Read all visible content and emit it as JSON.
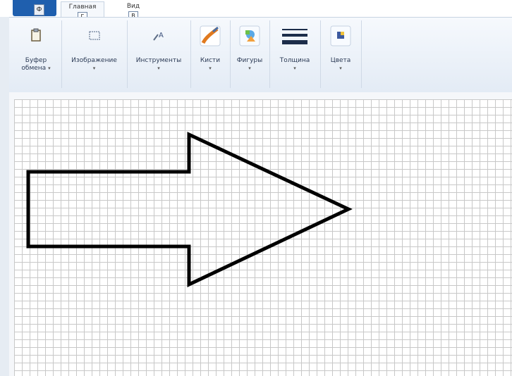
{
  "app": {
    "menu_key": "Ф"
  },
  "tabs": [
    {
      "label": "Главная",
      "key": "Г"
    },
    {
      "label": "Вид",
      "key": "В"
    }
  ],
  "ribbon": {
    "clipboard": {
      "label_line1": "Буфер",
      "label_line2": "обмена",
      "arrow": "▾",
      "icon": "clipboard-icon"
    },
    "image": {
      "label": "Изображение",
      "arrow": "▾",
      "icon": "image-select-icon"
    },
    "tools": {
      "label": "Инструменты",
      "arrow": "▾",
      "icon": "tools-icon"
    },
    "brushes": {
      "label": "Кисти",
      "arrow": "▾",
      "icon": "brush-icon"
    },
    "shapes": {
      "label": "Фигуры",
      "arrow": "▾",
      "icon": "shapes-icon"
    },
    "thickness": {
      "label": "Толщина",
      "arrow": "▾",
      "icon": "thickness-icon"
    },
    "colors": {
      "label": "Цвета",
      "arrow": "▾",
      "icon": "colors-icon"
    }
  },
  "canvas": {
    "gridlines": true,
    "shape": "right-arrow outline",
    "stroke_color": "#000000"
  },
  "colors": {
    "accent": "#1f5fae",
    "ribbon_bg": "#e9eff7",
    "grid_line": "#c8c8c8"
  }
}
